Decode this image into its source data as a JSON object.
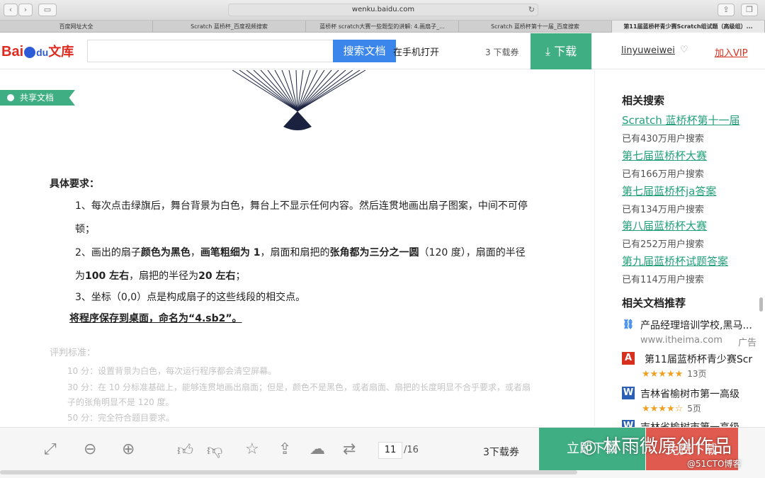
{
  "browser": {
    "url": "wenku.baidu.com",
    "tabs": [
      "百度网址大全",
      "Scratch 蓝桥杯_百度视频搜索",
      "蓝桥杯 scratch大赛一些题型的讲解: 4.画扇子_...",
      "Scratch 蓝桥杯第十一届_百度搜索",
      "第11届蓝桥杯青少赛Scratch组试题（高级组）..."
    ],
    "active_tab": 4
  },
  "header": {
    "logo_bai": "Bai",
    "logo_du": "du",
    "logo_wenku": "文库",
    "search_button": "搜索文档",
    "mobile": "在手机打开",
    "download_count": "3 下载券",
    "download_button": "下载",
    "username": "linyuweiwei",
    "vip": "加入VIP"
  },
  "doc": {
    "share_tag": "共享文档",
    "req_title": "具体要求：",
    "p1a": "1、每次点击绿旗后，舞台背景为白色，舞台上不显示任何内容。然后连贯地画出扇子图案，中间不可停",
    "p1b": "顿；",
    "p2a_1": "2、画出的扇子",
    "p2a_b1": "颜色为黑色",
    "p2a_2": "，",
    "p2a_b2": "画笔粗细为 1",
    "p2a_3": "，扇面和扇把的",
    "p2a_b3": "张角都为三分之一圆",
    "p2a_4": "（120 度），扇面的半径",
    "p2b_1": "为",
    "p2b_b1": "100 左右",
    "p2b_2": "，扇把的半径为",
    "p2b_b2": "20 左右",
    "p2b_3": "；",
    "p3": "3、坐标（0,0）点是构成扇子的这些线段的相交点。",
    "save": "将程序保存到桌面，命名为“4.sb2”。",
    "score_title": "评判标准：",
    "score1": "10 分：设置背景为白色，每次运行程序都会清空屏幕。",
    "score2a": "30 分：在 10 分标准基础上，能够连贯地画出扇面；但是，颜色不是黑色，或者扇面、扇把的长度明显不合乎要求，或者扇",
    "score2b": "子的张角明显不是 120 度。",
    "score3": "50 分：完全符合题目要求。"
  },
  "sidebar": {
    "related_title": "相关搜索",
    "related": [
      {
        "label": "Scratch 蓝桥杯第十一届",
        "sub": "已有430万用户搜索"
      },
      {
        "label": "第七届蓝桥杯大赛",
        "sub": "已有166万用户搜索"
      },
      {
        "label": "第七届蓝桥杯ja答案",
        "sub": "已有134万用户搜索"
      },
      {
        "label": "第八届蓝桥杯大赛",
        "sub": "已有252万用户搜索"
      },
      {
        "label": "第九届蓝桥杯试题答案",
        "sub": "已有114万用户搜索"
      }
    ],
    "rec_title": "相关文档推荐",
    "recs": [
      {
        "title": "产品经理培训学校,黑马...",
        "sub": "www.itheima.com",
        "ad": "广告"
      },
      {
        "title": "第11届蓝桥杯青少赛Scr",
        "stars": "★★★★★",
        "count": "13页"
      },
      {
        "title": "吉林省榆树市第一高级",
        "stars": "★★★★☆",
        "count": "5页"
      },
      {
        "title": "吉林省榆树市第一高级"
      }
    ]
  },
  "bottom": {
    "page_current": "11",
    "page_total": "/16",
    "download_count": "3下载券",
    "download_now": "立即下载",
    "free_download": "免费下载",
    "watermark": "林雨微原创作品",
    "watermark2": "@51CTO博客"
  }
}
